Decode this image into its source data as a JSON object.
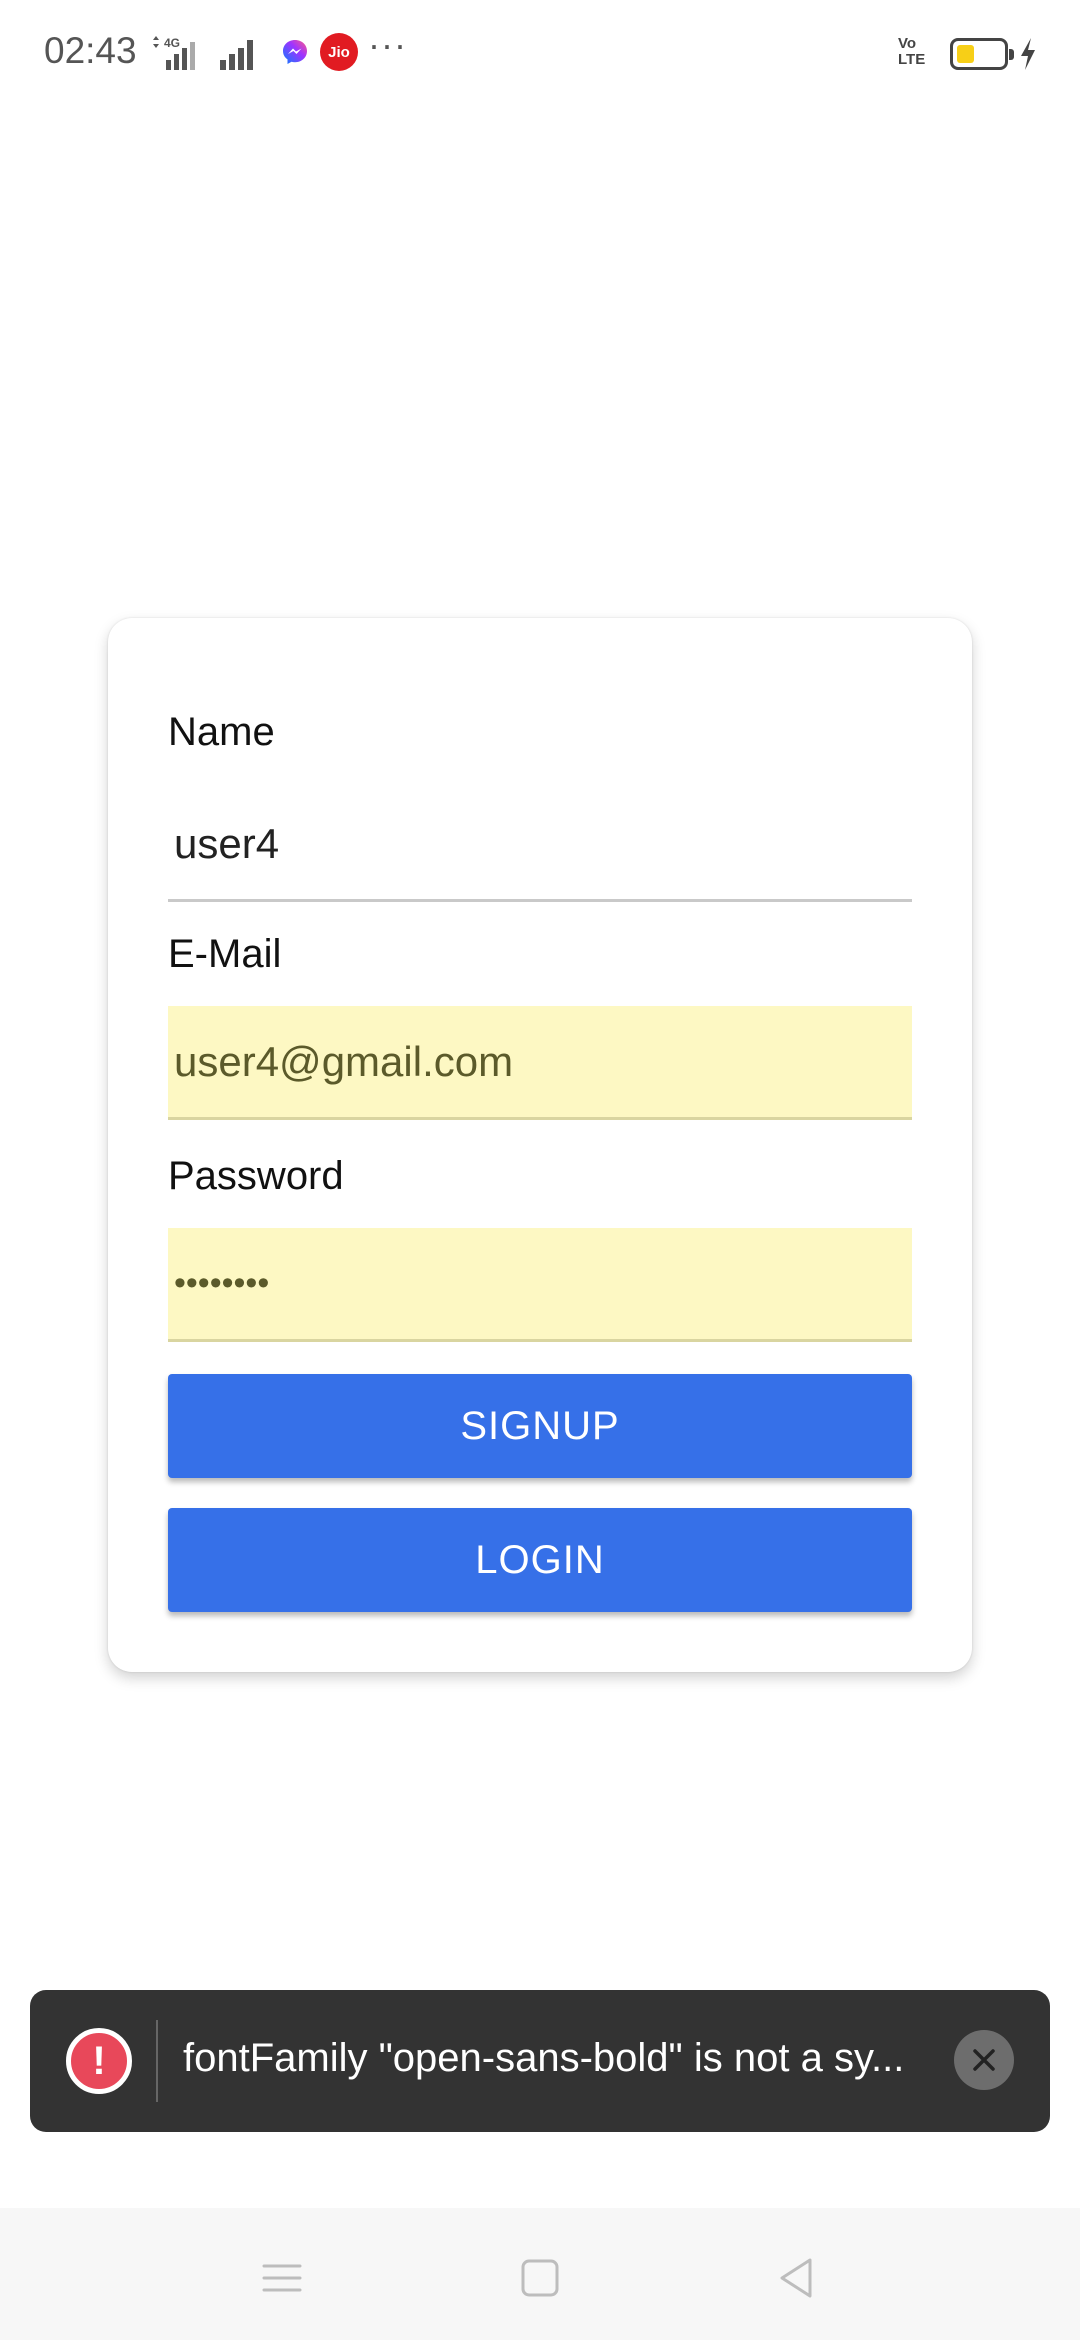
{
  "status_bar": {
    "time": "02:43",
    "network_label": "4G",
    "jio_label": "Jio",
    "more_label": "···",
    "volte_label_line1": "Vo",
    "volte_label_line2": "LTE",
    "battery_level": 0.35,
    "icons": [
      "signal-icon",
      "messenger-icon",
      "jio-icon",
      "battery-icon",
      "charging-icon"
    ]
  },
  "form": {
    "name_label": "Name",
    "name_value": "user4",
    "email_label": "E-Mail",
    "email_value": "user4@gmail.com",
    "password_label": "Password",
    "password_value": "••••••••",
    "signup_label": "SIGNUP",
    "login_label": "LOGIN",
    "autofill_color": "#fdf8c3",
    "button_color": "#3670e8"
  },
  "toast": {
    "message": "fontFamily \"open-sans-bold\" is not a sy...",
    "icon": "error-icon",
    "close_icon": "close-icon"
  },
  "nav_bar": {
    "icons": [
      "menu-icon",
      "home-icon",
      "back-icon"
    ]
  }
}
